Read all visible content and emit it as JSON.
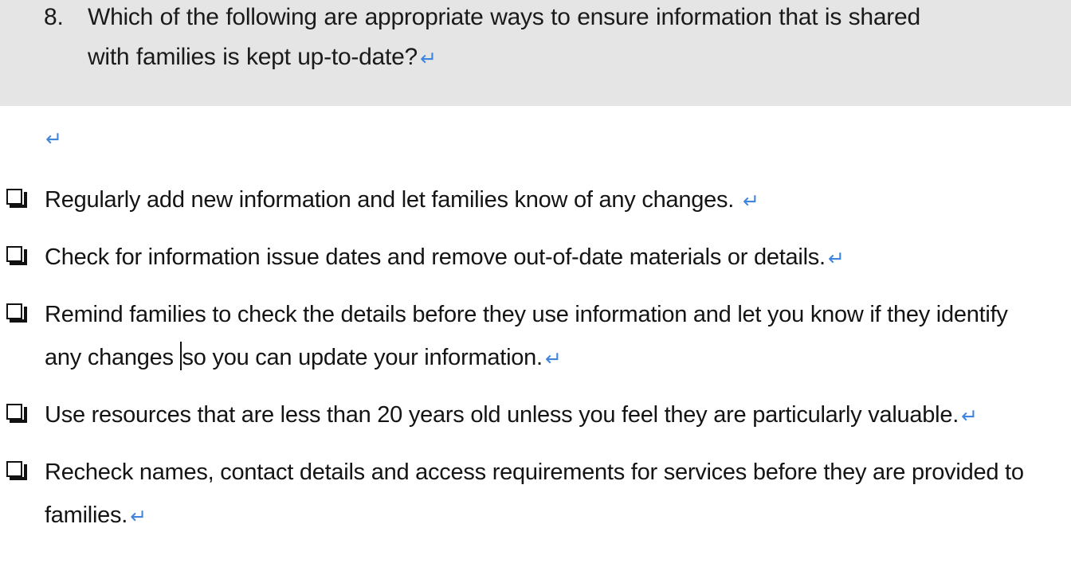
{
  "document": {
    "type": "word-processor-page",
    "background_color": "#ffffff",
    "highlight_color": "#e5e5e5",
    "text_color": "#141414",
    "paragraph_mark_color": "#3f85dd",
    "paragraph_mark_glyph": "↵"
  },
  "question": {
    "number": "8.",
    "line1": "Which of the following are appropriate ways to ensure information that is shared",
    "line2": "with families is kept up-to-date?",
    "paragraph_mark": "↵"
  },
  "spacer": {
    "paragraph_mark": "↵"
  },
  "options": [
    {
      "checkbox": "❑",
      "checked": false,
      "text": "Regularly add new information and let families know of any changes. ",
      "paragraph_mark": "↵"
    },
    {
      "checkbox": "❑",
      "checked": false,
      "text": "Check for information issue dates and remove out-of-date materials or details.",
      "paragraph_mark": "↵"
    },
    {
      "checkbox": "❑",
      "checked": false,
      "text_before_caret": "Remind families to check the details before they use information and let you know if they identify any changes ",
      "text_after_caret": "so you can update your information.",
      "has_caret": true,
      "paragraph_mark": "↵"
    },
    {
      "checkbox": "❑",
      "checked": false,
      "text": "Use resources that are less than 20 years old unless you feel they are particularly valuable.",
      "paragraph_mark": "↵"
    },
    {
      "checkbox": "❑",
      "checked": false,
      "text": "Recheck names, contact details and access requirements for services before they are provided to families.",
      "paragraph_mark": "↵"
    }
  ]
}
